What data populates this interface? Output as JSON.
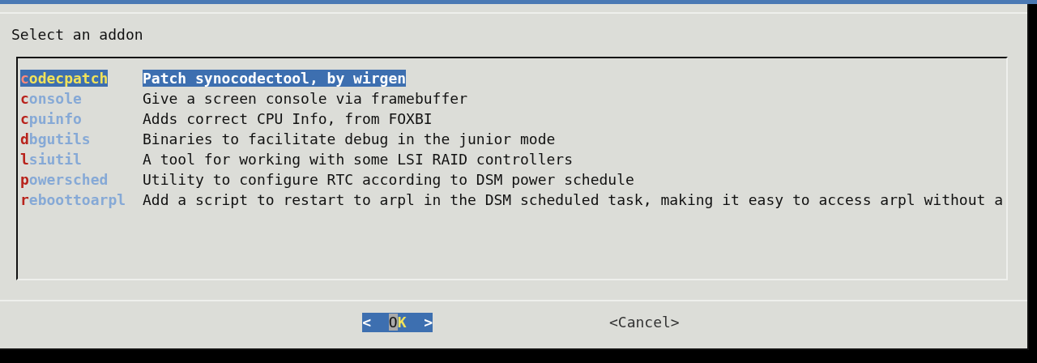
{
  "dialog": {
    "prompt": "Select an addon",
    "addons": [
      {
        "name": "codecpatch",
        "description": "Patch synocodectool, by wirgen",
        "selected": true
      },
      {
        "name": "console",
        "description": "Give a screen console via framebuffer",
        "selected": false
      },
      {
        "name": "cpuinfo",
        "description": "Adds correct CPU Info, from FOXBI",
        "selected": false
      },
      {
        "name": "dbgutils",
        "description": "Binaries to facilitate debug in the junior mode",
        "selected": false
      },
      {
        "name": "lsiutil",
        "description": "A tool for working with some LSI RAID controllers",
        "selected": false
      },
      {
        "name": "powersched",
        "description": "Utility to configure RTC according to DSM power schedule",
        "selected": false
      },
      {
        "name": "reboottoarpl",
        "description": "Add a script to restart to arpl in the DSM scheduled task, making it easy to access arpl without a",
        "selected": false
      }
    ],
    "buttons": [
      {
        "label": "<  OK  >",
        "selected": true
      },
      {
        "label": "<Cancel>",
        "selected": false
      }
    ]
  }
}
